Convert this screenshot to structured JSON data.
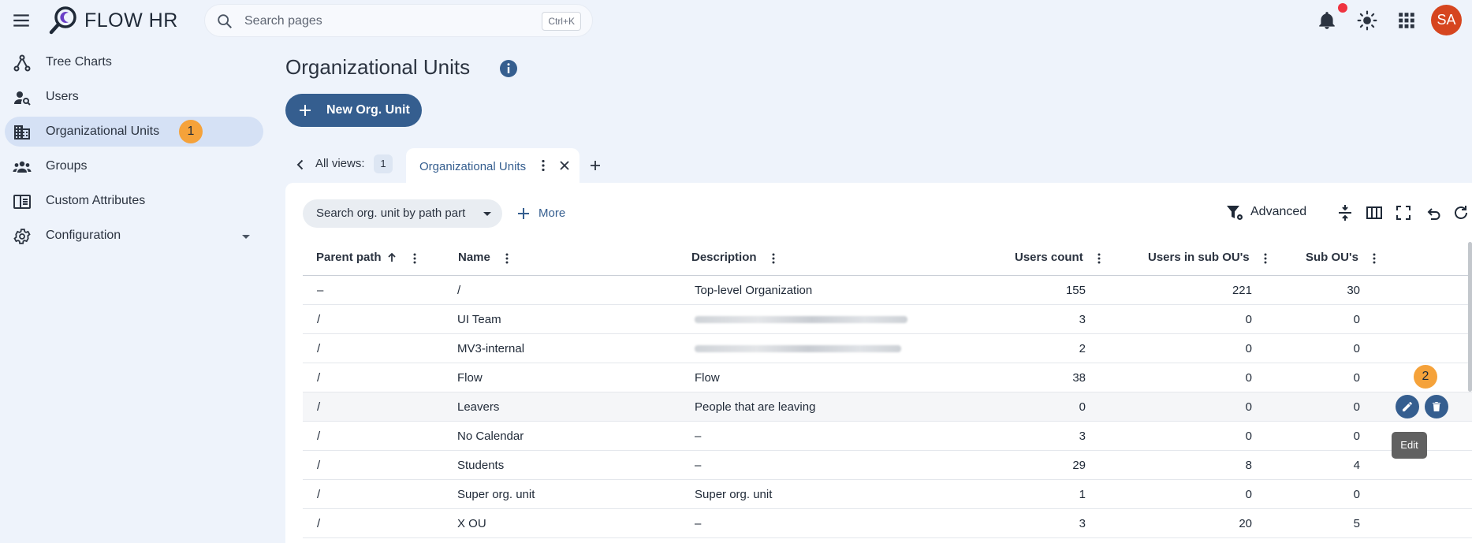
{
  "app": {
    "brand": "FLOW HR"
  },
  "search": {
    "placeholder": "Search pages",
    "shortcut": "Ctrl+K"
  },
  "user": {
    "initials": "SA"
  },
  "sidebar": {
    "items": [
      {
        "label": "Tree Charts",
        "icon": "tree-chart-icon"
      },
      {
        "label": "Users",
        "icon": "user-search-icon"
      },
      {
        "label": "Organizational Units",
        "icon": "building-icon",
        "active": true,
        "badge": "1"
      },
      {
        "label": "Groups",
        "icon": "groups-icon"
      },
      {
        "label": "Custom Attributes",
        "icon": "attributes-icon"
      },
      {
        "label": "Configuration",
        "icon": "gear-icon",
        "expandable": true
      }
    ]
  },
  "main": {
    "title": "Organizational Units",
    "new_button": "New Org. Unit",
    "views": {
      "label": "All views:",
      "count": "1",
      "active_tab": "Organizational Units"
    },
    "filters": {
      "chip": "Search org. unit by path part",
      "more": "More",
      "advanced": "Advanced"
    },
    "table": {
      "columns": [
        "Parent path",
        "Name",
        "Description",
        "Users count",
        "Users in sub OU's",
        "Sub OU's"
      ],
      "rows": [
        {
          "parent": "–",
          "name": "/",
          "description": "Top-level Organization",
          "users": "155",
          "sub_users": "221",
          "sub_ous": "30"
        },
        {
          "parent": "/",
          "name": "UI Team",
          "description": "",
          "users": "3",
          "sub_users": "0",
          "sub_ous": "0"
        },
        {
          "parent": "/",
          "name": "MV3-internal",
          "description": "",
          "users": "2",
          "sub_users": "0",
          "sub_ous": "0"
        },
        {
          "parent": "/",
          "name": "Flow",
          "description": "Flow",
          "users": "38",
          "sub_users": "0",
          "sub_ous": "0"
        },
        {
          "parent": "/",
          "name": "Leavers",
          "description": "People that are leaving",
          "users": "0",
          "sub_users": "0",
          "sub_ous": "0"
        },
        {
          "parent": "/",
          "name": "No Calendar",
          "description": "–",
          "users": "3",
          "sub_users": "0",
          "sub_ous": "0"
        },
        {
          "parent": "/",
          "name": "Students",
          "description": "–",
          "users": "29",
          "sub_users": "8",
          "sub_ous": "4"
        },
        {
          "parent": "/",
          "name": "Super org. unit",
          "description": "Super org. unit",
          "users": "1",
          "sub_users": "0",
          "sub_ous": "0"
        },
        {
          "parent": "/",
          "name": "X OU",
          "description": "–",
          "users": "3",
          "sub_users": "20",
          "sub_ous": "5"
        }
      ],
      "hover_row_badge": "2",
      "tooltip": "Edit"
    }
  },
  "colors": {
    "primary": "#355e8f",
    "badge": "#f5a23a",
    "avatar": "#d6451f",
    "notification": "#ef3340"
  }
}
